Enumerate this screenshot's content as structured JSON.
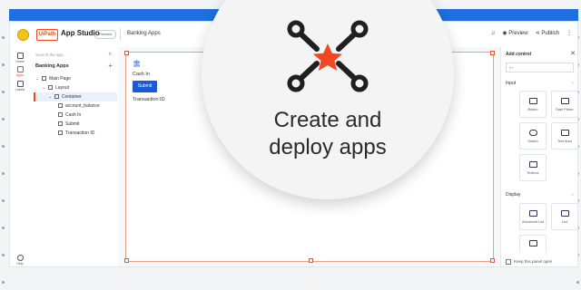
{
  "header": {
    "logo_text": "UiPath",
    "app_name": "App Studio",
    "badge": "Preview",
    "breadcrumb": "Banking Apps",
    "preview_label": "Preview",
    "publish_label": "Publish"
  },
  "rail": {
    "items": [
      {
        "label": "Home",
        "icon": "home-icon"
      },
      {
        "label": "Apps",
        "icon": "apps-icon"
      },
      {
        "label": "Labels",
        "icon": "labels-icon"
      },
      {
        "label": "Help",
        "icon": "help-icon"
      }
    ]
  },
  "leftpanel": {
    "search_placeholder": "Search the app...",
    "title": "Banking Apps",
    "add_symbol": "+",
    "tree": [
      {
        "label": "Main Page",
        "level": 0,
        "toggle": "⌄"
      },
      {
        "label": "Layout",
        "level": 1,
        "toggle": "⌄"
      },
      {
        "label": "Container",
        "level": 2,
        "toggle": "⌄",
        "selected": true
      },
      {
        "label": "account_balance",
        "level": 3,
        "toggle": ""
      },
      {
        "label": "Cash In",
        "level": 3,
        "toggle": ""
      },
      {
        "label": "Submit",
        "level": 3,
        "toggle": ""
      },
      {
        "label": "Transaction ID",
        "level": 3,
        "toggle": ""
      }
    ]
  },
  "canvas": {
    "cash_label": "Cash In",
    "submit_label": "Submit",
    "txid_label": "Transaction ID"
  },
  "rightpanel": {
    "title": "Add control",
    "close": "✕",
    "search_value": "I",
    "input_section": "Input",
    "input_tiles": [
      "Button",
      "Date Picker",
      "Switch",
      "Text Area",
      "Textbox"
    ],
    "display_section": "Display",
    "display_tiles": [
      "Advanced List",
      "List"
    ],
    "keep_open": "Keep this panel open"
  },
  "overlay": {
    "line1": "Create and",
    "line2": "deploy apps",
    "accent_color": "#f24822",
    "icon_color": "#1f1f1f"
  },
  "colors": {
    "topbar": "#1f6fe0",
    "primary_button": "#1a5ad7",
    "brand": "#fa4616"
  }
}
